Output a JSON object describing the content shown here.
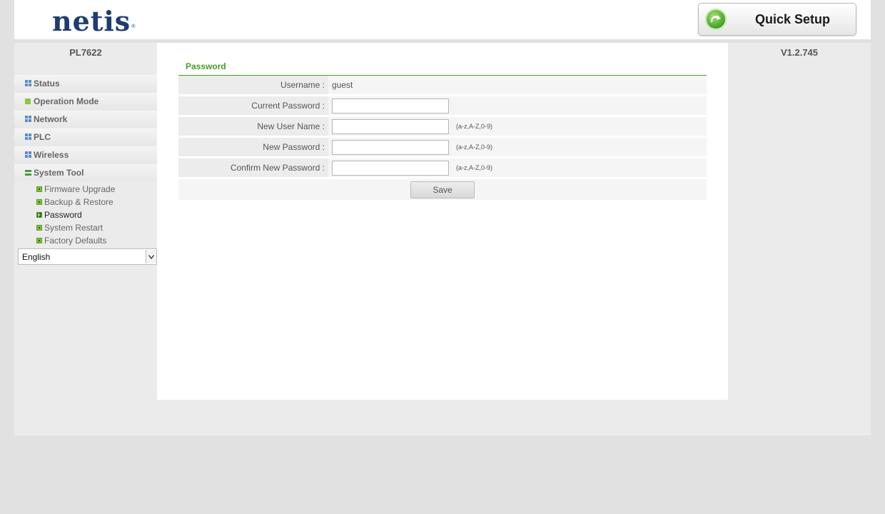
{
  "header": {
    "logo_text": "netis",
    "logo_mark": "®",
    "quick_setup_label": "Quick Setup"
  },
  "device": {
    "model": "PL7622",
    "version": "V1.2.745"
  },
  "sidebar": {
    "items": [
      {
        "label": "Status",
        "icon": "grid-icon"
      },
      {
        "label": "Operation Mode",
        "icon": "green-square-icon"
      },
      {
        "label": "Network",
        "icon": "grid-icon"
      },
      {
        "label": "PLC",
        "icon": "grid-icon"
      },
      {
        "label": "Wireless",
        "icon": "grid-icon"
      },
      {
        "label": "System Tool",
        "icon": "minus-icon",
        "expanded": true
      }
    ],
    "subitems": [
      {
        "label": "Firmware Upgrade"
      },
      {
        "label": "Backup & Restore"
      },
      {
        "label": "Password",
        "active": true
      },
      {
        "label": "System Restart"
      },
      {
        "label": "Factory Defaults"
      }
    ],
    "language": "English"
  },
  "main": {
    "section_title": "Password",
    "fields": {
      "username_label": "Username :",
      "username_value": "guest",
      "current_password_label": "Current Password :",
      "new_user_name_label": "New User Name :",
      "new_password_label": "New Password :",
      "confirm_password_label": "Confirm New Password :",
      "hint": "(a-z,A-Z,0-9)"
    },
    "save_label": "Save"
  },
  "colors": {
    "accent_green": "#4a9a2a",
    "logo_navy": "#1e3c6e",
    "frame_gray": "#ebebeb"
  }
}
